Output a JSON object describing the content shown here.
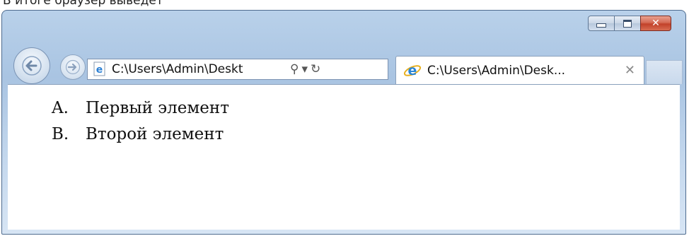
{
  "caption_text": "В итоге браузер выведет",
  "window_controls": {
    "minimize": "minimize",
    "maximize": "maximize",
    "close_glyph": "✕"
  },
  "navigation": {
    "back_icon": "back-arrow-icon",
    "forward_icon": "forward-arrow-icon"
  },
  "address_bar": {
    "url": "C:\\Users\\Admin\\Deskt",
    "search_glyph": "⚲",
    "dropdown_glyph": "▾",
    "refresh_glyph": "↻"
  },
  "tab": {
    "title": "C:\\Users\\Admin\\Desk...",
    "close_glyph": "✕"
  },
  "page": {
    "list": [
      {
        "marker": "A.",
        "text": "Первый элемент"
      },
      {
        "marker": "B.",
        "text": "Второй элемент"
      }
    ]
  }
}
